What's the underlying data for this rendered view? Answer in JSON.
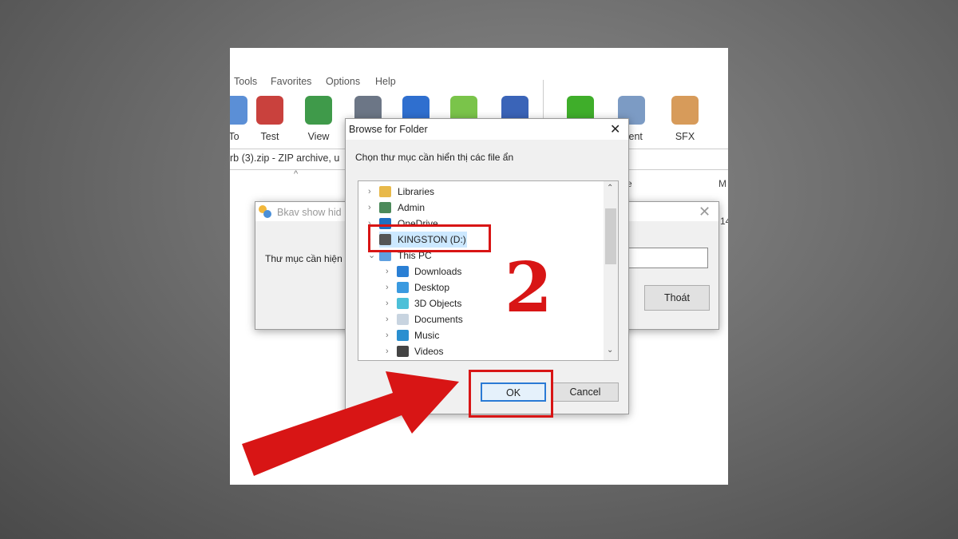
{
  "app": {
    "menu": [
      "Tools",
      "Favorites",
      "Options",
      "Help"
    ],
    "toolbar": [
      {
        "label": "To",
        "icon": "extract-to-icon",
        "color": "#5b8fd6"
      },
      {
        "label": "Test",
        "icon": "test-clipboard-icon",
        "color": "#c9413d"
      },
      {
        "label": "View",
        "icon": "book-icon",
        "color": "#3f9a4a"
      },
      {
        "label": "",
        "icon": "trash-icon",
        "color": "#6c7686"
      },
      {
        "label": "",
        "icon": "find-icon",
        "color": "#2f6fcf"
      },
      {
        "label": "",
        "icon": "wizard-icon",
        "color": "#7ac44a"
      },
      {
        "label": "",
        "icon": "info-icon",
        "color": "#3a64b8"
      },
      {
        "label": "",
        "icon": "virus-scan-icon",
        "color": "#3fae2a"
      },
      {
        "label": "ment",
        "icon": "comment-icon",
        "color": "#7c9bc4"
      },
      {
        "label": "SFX",
        "icon": "sfx-box-icon",
        "color": "#d79b5a"
      }
    ],
    "address": "rb (3).zip - ZIP archive, u",
    "col_right_1": "e",
    "col_right_2": "M",
    "cell_right": "14"
  },
  "bkav": {
    "title": "Bkav show hid",
    "label": "Thư mục cần hiện",
    "exit_button": "Thoát"
  },
  "browse": {
    "title": "Browse for Folder",
    "prompt": "Chọn thư mục cần hiển thị các file ẩn",
    "tree": [
      {
        "label": "Libraries",
        "level": 1,
        "icon": "libraries-icon",
        "expanded": false
      },
      {
        "label": "Admin",
        "level": 1,
        "icon": "user-icon",
        "expanded": false
      },
      {
        "label": "OneDrive",
        "level": 1,
        "icon": "cloud-icon",
        "expanded": false
      },
      {
        "label": "KINGSTON (D:)",
        "level": 1,
        "icon": "drive-icon",
        "selected": true
      },
      {
        "label": "This PC",
        "level": 1,
        "icon": "computer-icon",
        "expanded": true
      },
      {
        "label": "Downloads",
        "level": 2,
        "icon": "download-icon"
      },
      {
        "label": "Desktop",
        "level": 2,
        "icon": "desktop-icon"
      },
      {
        "label": "3D Objects",
        "level": 2,
        "icon": "cube-icon"
      },
      {
        "label": "Documents",
        "level": 2,
        "icon": "document-icon"
      },
      {
        "label": "Music",
        "level": 2,
        "icon": "music-icon"
      },
      {
        "label": "Videos",
        "level": 2,
        "icon": "video-icon"
      }
    ],
    "ok": "OK",
    "cancel": "Cancel"
  },
  "annotation": {
    "step": "2",
    "color": "#d81515"
  }
}
